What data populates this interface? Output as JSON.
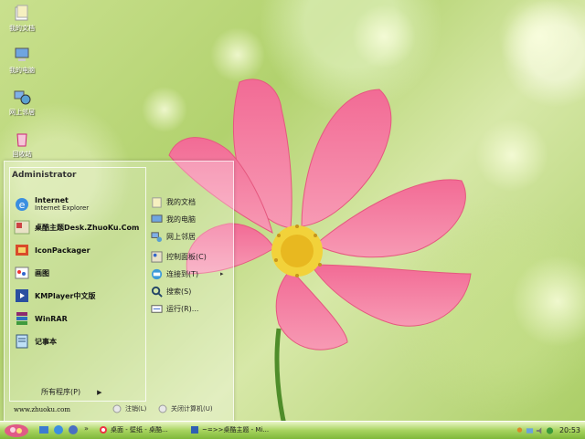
{
  "desktop": {
    "icons": [
      {
        "label": "我的文档",
        "icon": "my-documents-icon"
      },
      {
        "label": "我的电脑",
        "icon": "my-computer-icon"
      },
      {
        "label": "网上邻居",
        "icon": "network-places-icon"
      },
      {
        "label": "回收站",
        "icon": "recycle-bin-icon"
      }
    ]
  },
  "start_menu": {
    "user": "Administrator",
    "pinned": [
      {
        "title": "Internet",
        "subtitle": "Internet Explorer",
        "icon": "internet-explorer-icon"
      },
      {
        "title": "桌酷主题Desk.ZhuoKu.Com",
        "icon": "zhuoku-theme-icon"
      },
      {
        "title": "IconPackager",
        "icon": "iconpackager-icon"
      },
      {
        "title": "画图",
        "icon": "paint-icon"
      },
      {
        "title": "KMPlayer中文版",
        "icon": "kmplayer-icon"
      },
      {
        "title": "WinRAR",
        "icon": "winrar-icon"
      },
      {
        "title": "记事本",
        "icon": "notepad-icon"
      }
    ],
    "all_programs": "所有程序(P)",
    "right": [
      {
        "label": "我的文档",
        "icon": "my-documents-icon"
      },
      {
        "label": "我的电脑",
        "icon": "my-computer-icon"
      },
      {
        "label": "网上邻居",
        "icon": "network-places-icon"
      },
      {
        "label": "控制面板(C)",
        "icon": "control-panel-icon"
      },
      {
        "label": "连接到(T)",
        "icon": "connect-to-icon",
        "arrow": "▸"
      },
      {
        "label": "搜索(S)",
        "icon": "search-icon"
      },
      {
        "label": "运行(R)...",
        "icon": "run-icon"
      }
    ],
    "site": "www.zhuoku.com",
    "logoff": "注销(L)",
    "shutdown": "关闭计算机(U)"
  },
  "taskbar": {
    "tasks": [
      {
        "label": "桌面 - 壁纸 - 桌酷...",
        "icon": "browser-icon"
      },
      {
        "label": "~=>>桌酷主题 - Mi...",
        "icon": "word-doc-icon"
      }
    ],
    "clock": "20:53"
  },
  "colors": {
    "taskbar_green": "#7fb83a",
    "petal_pink": "#f06f93",
    "flower_center": "#f2d23a"
  }
}
